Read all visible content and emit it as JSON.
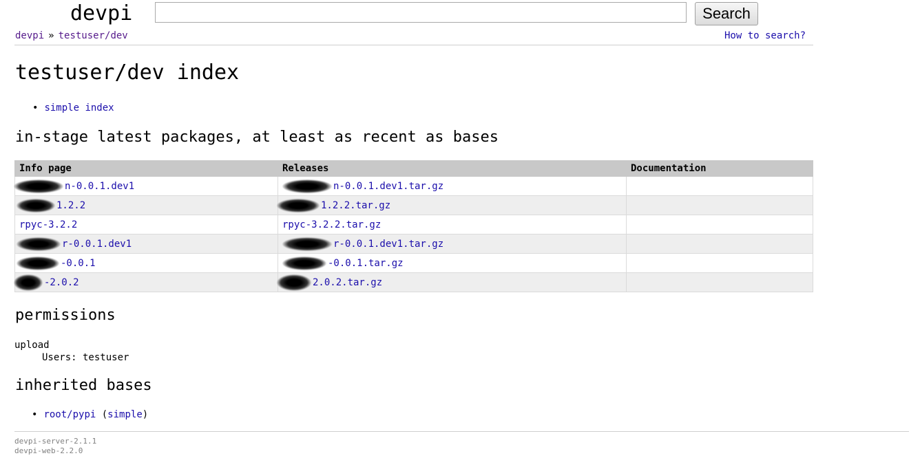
{
  "header": {
    "logo": "devpi",
    "search_value": "",
    "search_button": "Search",
    "breadcrumb": {
      "root": "devpi",
      "separator": "»",
      "index": "testuser/dev"
    },
    "how_to_search": "How to search?"
  },
  "page_title": "testuser/dev index",
  "index_links": [
    "simple index"
  ],
  "packages_heading": "in-stage latest packages, at least as recent as bases",
  "table": {
    "columns": [
      "Info page",
      "Releases",
      "Documentation"
    ],
    "rows": [
      {
        "info": "n-0.0.1.dev1",
        "release": "n-0.0.1.dev1.tar.gz",
        "doc": "",
        "redacted": true
      },
      {
        "info": "1.2.2",
        "release": "1.2.2.tar.gz",
        "doc": "",
        "redacted": true
      },
      {
        "info": "rpyc-3.2.2",
        "release": "rpyc-3.2.2.tar.gz",
        "doc": "",
        "redacted": false
      },
      {
        "info": "r-0.0.1.dev1",
        "release": "r-0.0.1.dev1.tar.gz",
        "doc": "",
        "redacted": true
      },
      {
        "info": "-0.0.1",
        "release": "-0.0.1.tar.gz",
        "doc": "",
        "redacted": true
      },
      {
        "info": "-2.0.2",
        "release": "2.0.2.tar.gz",
        "doc": "",
        "redacted": true
      }
    ]
  },
  "permissions": {
    "heading": "permissions",
    "upload_label": "upload",
    "users_line": "Users: testuser"
  },
  "bases": {
    "heading": "inherited bases",
    "link": "root/pypi",
    "open_paren": "(",
    "simple": "simple",
    "close_paren": ")"
  },
  "footer": {
    "server_version": "devpi-server-2.1.1",
    "web_version": "devpi-web-2.2.0"
  }
}
